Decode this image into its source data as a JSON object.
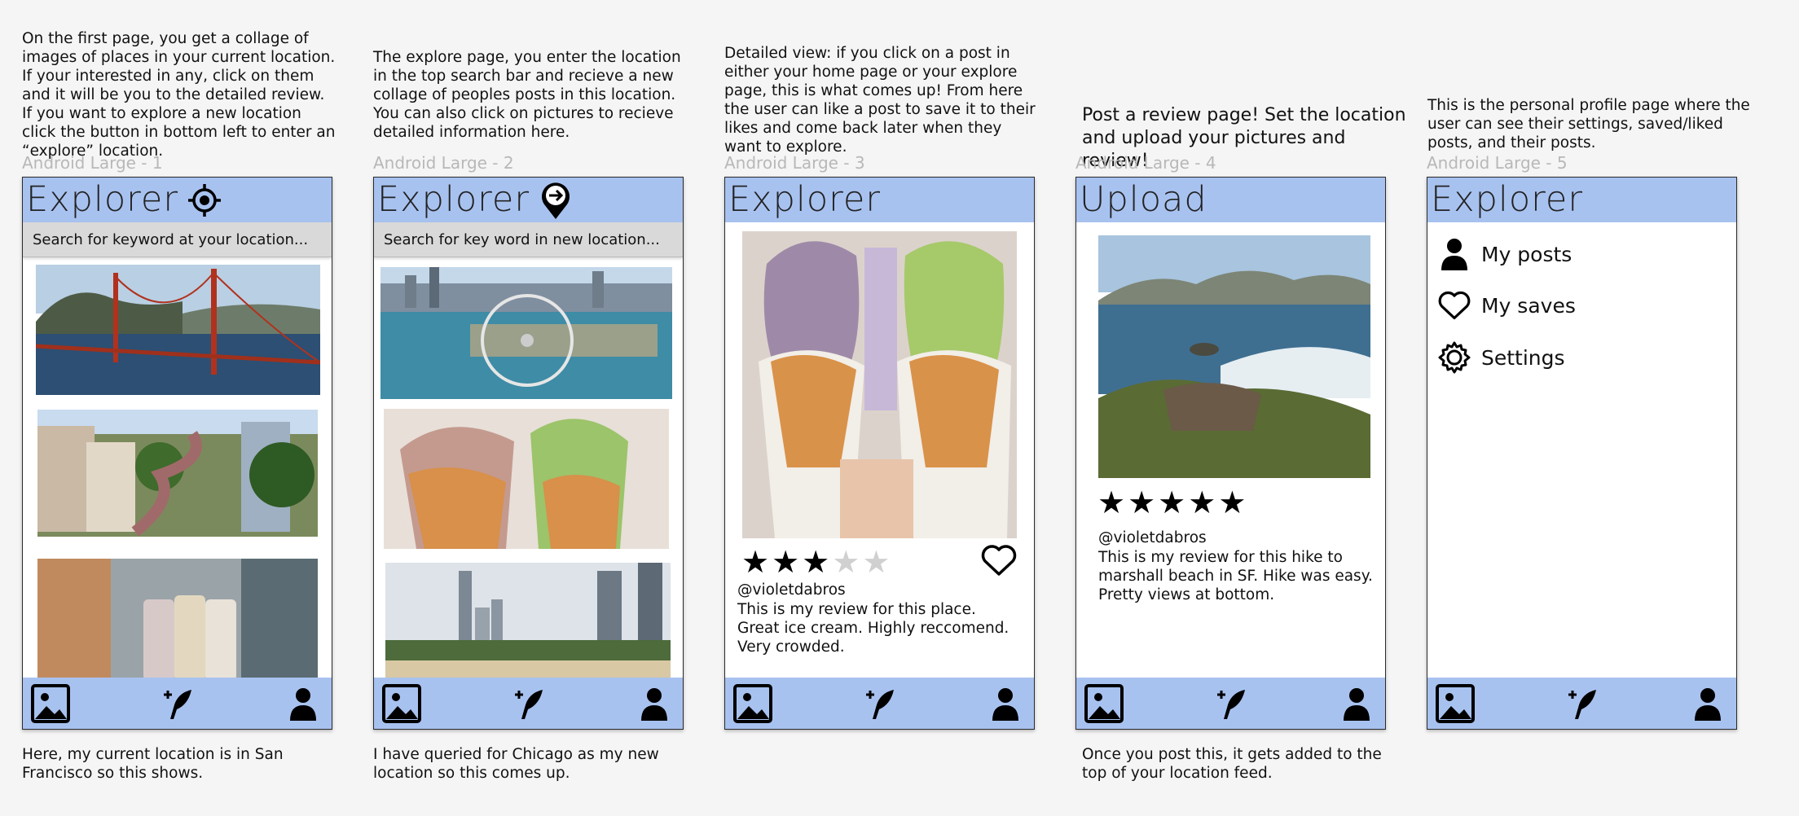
{
  "notes": {
    "frame1_top": "On the first page, you get a collage of images of places in your current location. If your interested in any, click on them and it will be you to the detailed review. If you want to explore a new location click the button in bottom left to enter an “explore” location.",
    "frame2_top": "The explore page, you enter the location in the top search bar and recieve a new collage of peoples posts in this location. You can also click on pictures to recieve detailed information here.",
    "frame3_top": "Detailed view: if you click on a post in either your home page or your explore page, this is what comes up! From here the user can like a post to save it to their likes and come back later when they want to explore.",
    "frame4_top": "Post a review page! Set the location and upload your pictures and review!",
    "frame5_top": "This is the personal profile page where the user can see their settings, saved/liked posts, and their posts.",
    "frame1_bottom": "Here, my current location is in San Francisco so this shows.",
    "frame2_bottom": "I have queried for Chicago as my new location so this comes up.",
    "frame4_bottom": "Once you post this, it gets added to the top of your location feed."
  },
  "frames": [
    {
      "label": "Android Large - 1",
      "title": "Explorer",
      "header_icon": "crosshair-icon",
      "search_placeholder": "Search for keyword at your location..."
    },
    {
      "label": "Android Large - 2",
      "title": "Explorer",
      "header_icon": "location-arrow-pin-icon",
      "search_placeholder": "Search for key word in new location..."
    },
    {
      "label": "Android Large - 3",
      "title": "Explorer",
      "rating": 3,
      "rating_max": 5,
      "handle": "@violetdabros",
      "review": "This is my review for this place. Great ice cream. Highly reccomend. Very crowded."
    },
    {
      "label": "Android Large - 4",
      "title": "Upload",
      "rating": 5,
      "rating_max": 5,
      "handle": "@violetdabros",
      "review": "This is my review for this hike to marshall beach in SF. Hike was easy. Pretty views at bottom."
    },
    {
      "label": "Android Large - 5",
      "title": "Explorer",
      "menu": [
        {
          "label": "My posts",
          "icon": "person-icon"
        },
        {
          "label": "My saves",
          "icon": "heart-icon"
        },
        {
          "label": "Settings",
          "icon": "gear-icon"
        }
      ]
    }
  ],
  "bottom_nav": {
    "icons": [
      "image-gallery-icon",
      "add-post-feather-icon",
      "profile-icon"
    ]
  },
  "colors": {
    "header": "#a8c2f0",
    "search_bar": "#d9d9d9",
    "canvas": "#f5f5f5",
    "label_gray": "#b8b8b8",
    "star_off": "#d0d0d0"
  }
}
